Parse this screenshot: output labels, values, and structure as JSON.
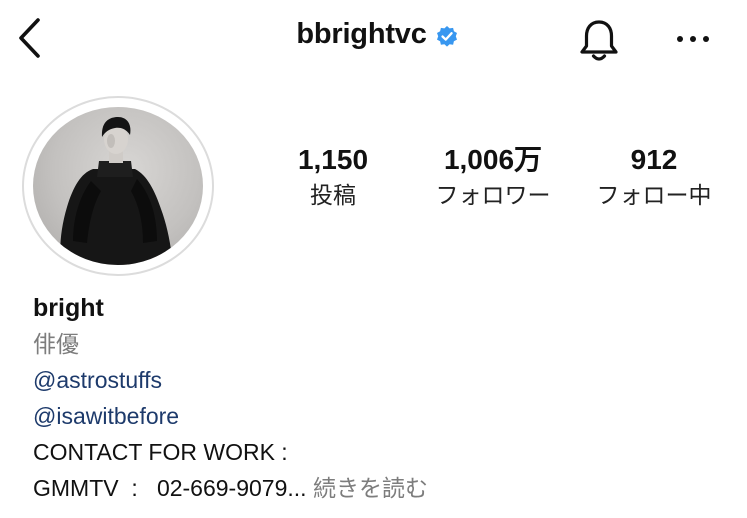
{
  "header": {
    "username": "bbrightvc",
    "verified": true,
    "icons": [
      "chevron-left-icon",
      "verified-badge-icon",
      "bell-icon",
      "more-horizontal-icon"
    ]
  },
  "stats": {
    "posts": {
      "value": "1,150",
      "label": "投稿"
    },
    "followers": {
      "value": "1,006万",
      "label": "フォロワー"
    },
    "following": {
      "value": "912",
      "label": "フォロー中"
    }
  },
  "bio": {
    "name": "bright",
    "category": "俳優",
    "links": [
      "@astrostuffs",
      "@isawitbefore"
    ],
    "line1": "CONTACT FOR WORK :",
    "line2": "GMMTV  :   02-669-9079...",
    "more": "続きを読む"
  },
  "colors": {
    "verified_badge": "#3897f0",
    "mention_link": "#1d3a6b",
    "secondary_text": "#7d7d7d"
  }
}
